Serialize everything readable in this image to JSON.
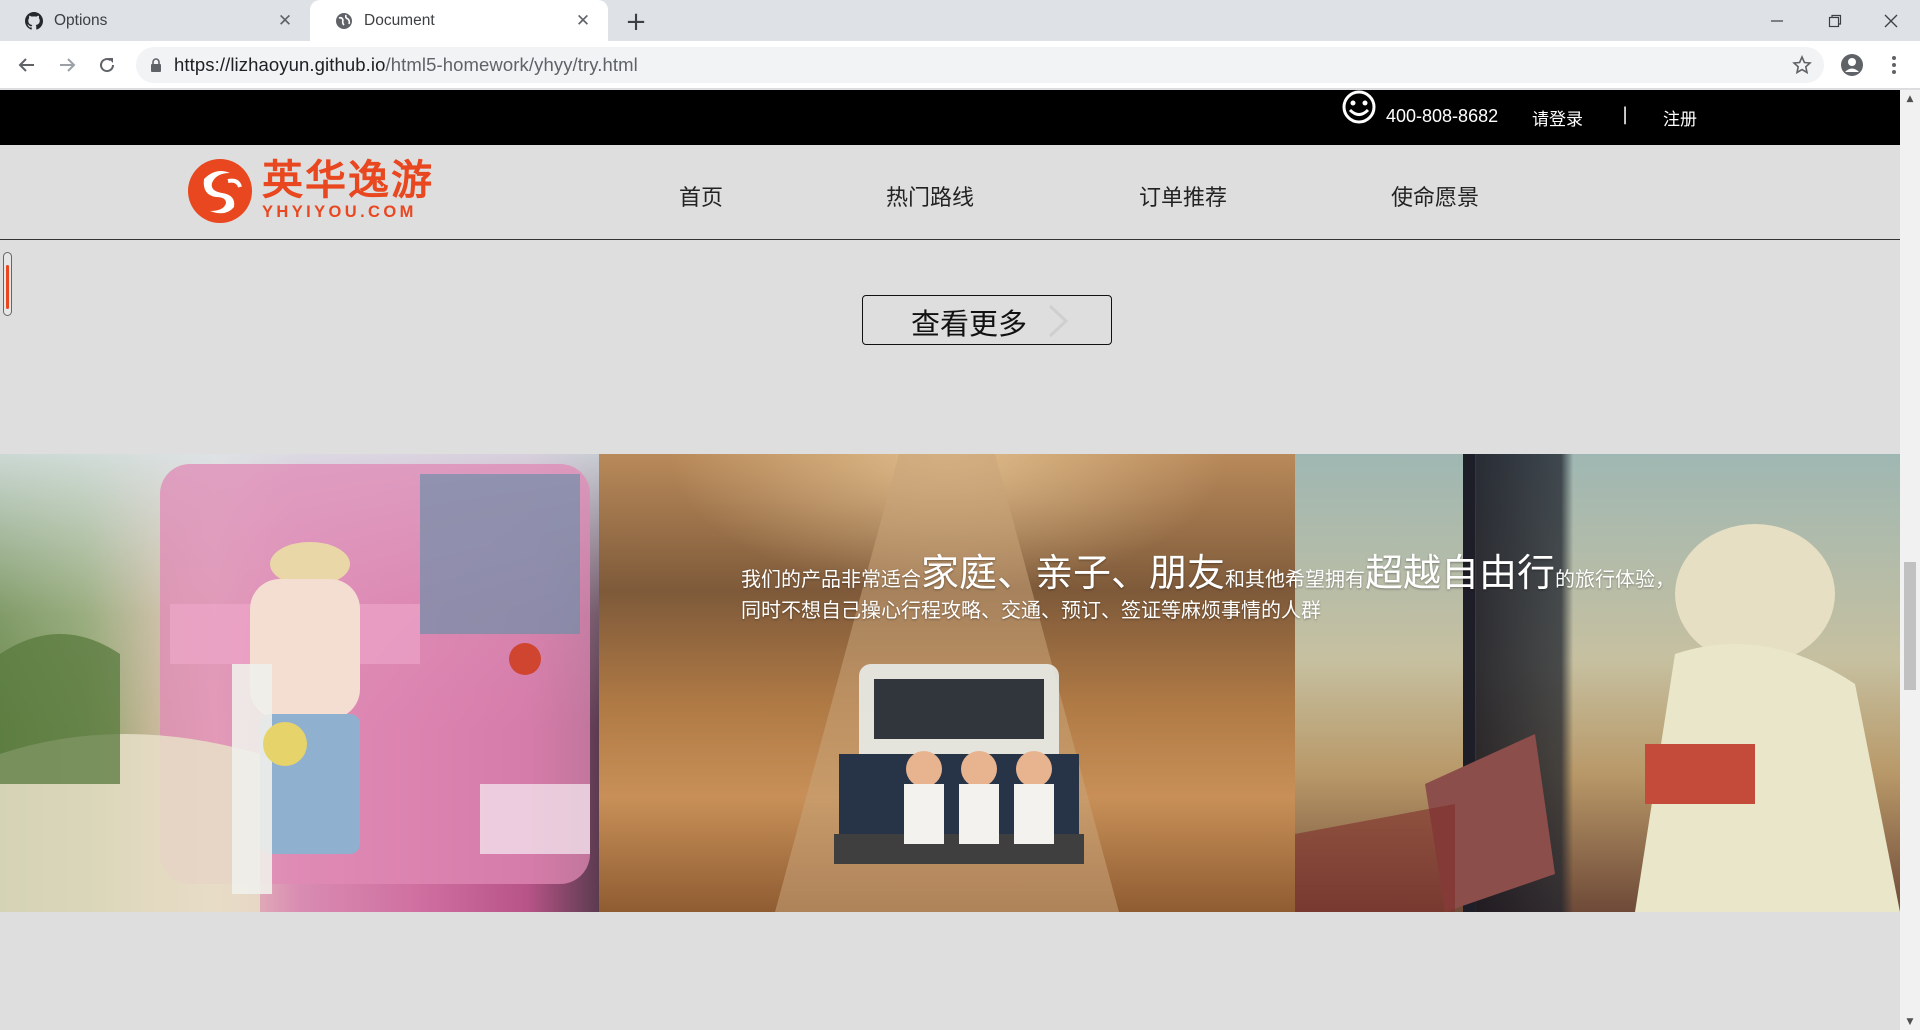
{
  "browser": {
    "tabs": [
      {
        "title": "Options",
        "icon": "github-icon"
      },
      {
        "title": "Document",
        "icon": "globe-icon"
      }
    ],
    "url_host": "https://lizhaoyun.github.io",
    "url_path": "/html5-homework/yhyy/try.html"
  },
  "topbar": {
    "phone": "400-808-8682",
    "login": "请登录",
    "separator": "|",
    "register": "注册"
  },
  "header": {
    "logo_cn": "英华逸游",
    "logo_en": "YHYIYOU.COM",
    "nav": [
      "首页",
      "热门路线",
      "订单推荐",
      "使命愿景"
    ]
  },
  "main": {
    "more_button": "查看更多",
    "banner": {
      "line1_parts": [
        {
          "text": "我们的产品非常适合",
          "size": "sm"
        },
        {
          "text": "家庭、亲子、朋友",
          "size": "lg"
        },
        {
          "text": "和其他希望拥有",
          "size": "sm"
        },
        {
          "text": "超越自由行",
          "size": "lg"
        },
        {
          "text": "的旅行体验，",
          "size": "sm"
        }
      ],
      "line2": "同时不想自己操心行程攻略、交通、预订、签证等麻烦事情的人群"
    }
  },
  "colors": {
    "brand": "#e8471f",
    "topbar_bg": "#000000",
    "page_bg": "#dedede"
  }
}
